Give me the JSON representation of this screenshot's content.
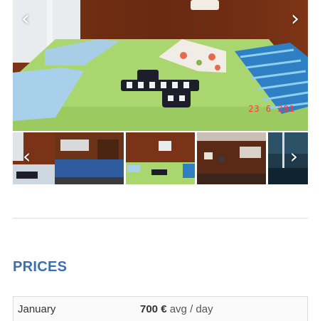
{
  "gallery": {
    "date_stamp": "23  6 201",
    "prev_arrow": "‹",
    "next_arrow": "›",
    "thumbnails": [
      {
        "name": "thumb-bunk"
      },
      {
        "name": "thumb-salon"
      },
      {
        "name": "thumb-bedroom"
      },
      {
        "name": "thumb-saloon-wood"
      },
      {
        "name": "thumb-deck"
      }
    ]
  },
  "prices": {
    "heading": "PRICES",
    "rows": [
      {
        "month": "January",
        "amount": "700 €",
        "unit": "avg / day"
      }
    ]
  },
  "colors": {
    "heading": "#3d6fb0",
    "divider": "#dcdcdc",
    "bedsheet": "#a9d66e",
    "wood": "#7a3316"
  }
}
